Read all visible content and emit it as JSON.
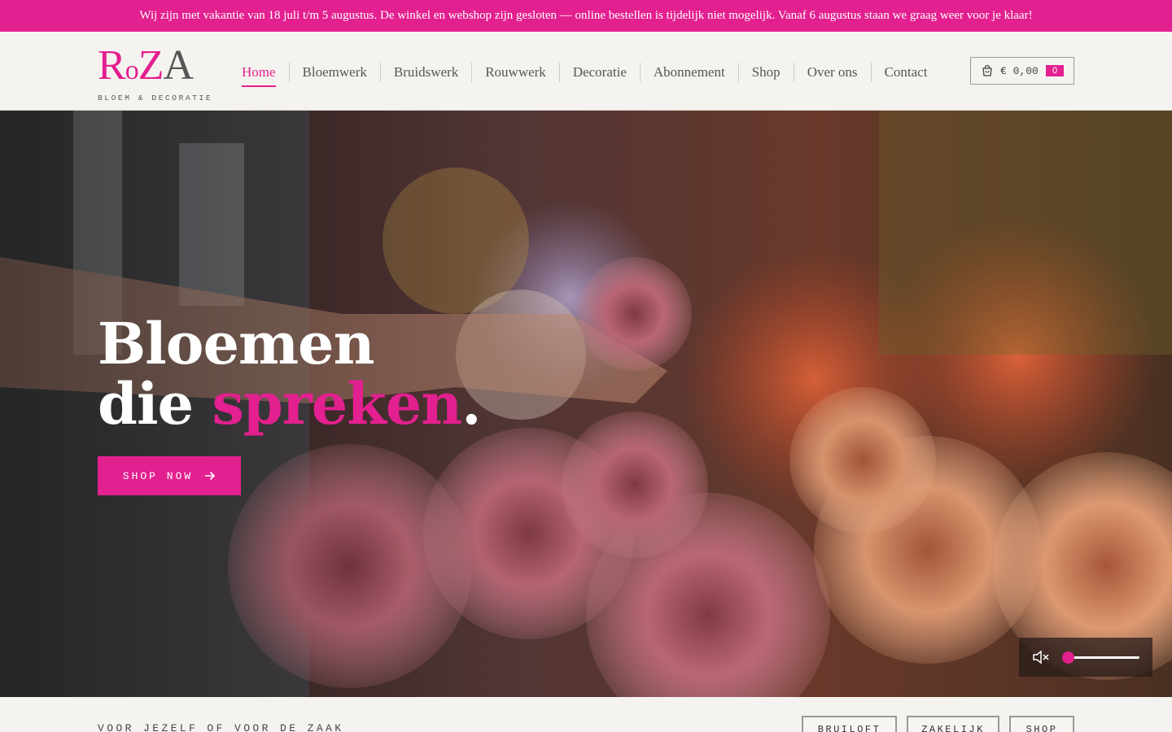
{
  "announcement": {
    "text": "Wij zijn met vakantie van 18 juli t/m 5 augustus. De winkel en webshop zijn gesloten — online bestellen is tijdelijk niet mogelijk. Vanaf 6 augustus staan we graag weer voor je klaar!"
  },
  "logo": {
    "letter_r": "R",
    "letter_o": "o",
    "letter_z": "Z",
    "letter_a": "A",
    "tagline": "BLOEM & DECORATIE"
  },
  "nav": {
    "items": [
      {
        "label": "Home",
        "active": true
      },
      {
        "label": "Bloemwerk",
        "active": false
      },
      {
        "label": "Bruidswerk",
        "active": false
      },
      {
        "label": "Rouwwerk",
        "active": false
      },
      {
        "label": "Decoratie",
        "active": false
      },
      {
        "label": "Abonnement",
        "active": false
      },
      {
        "label": "Shop",
        "active": false
      },
      {
        "label": "Over ons",
        "active": false
      },
      {
        "label": "Contact",
        "active": false
      }
    ]
  },
  "cart": {
    "icon": "shopping-bag-icon",
    "total": "€ 0,00",
    "count": "0"
  },
  "hero": {
    "title_line1": "Bloemen",
    "title_line2_prefix": "die ",
    "title_line2_accent": "spreken",
    "title_line2_suffix": ".",
    "cta_label": "SHOP NOW",
    "cta_icon": "arrow-right-icon"
  },
  "video_controls": {
    "mute_icon": "speaker-muted-icon",
    "volume_level": 0
  },
  "section": {
    "tagline": "VOOR JEZELF OF VOOR DE ZAAK",
    "pills": [
      "BRUILOFT",
      "ZAKELIJK",
      "SHOP"
    ]
  },
  "colors": {
    "accent": "#e3208f",
    "background": "#f5f3ef",
    "text": "#555555"
  }
}
